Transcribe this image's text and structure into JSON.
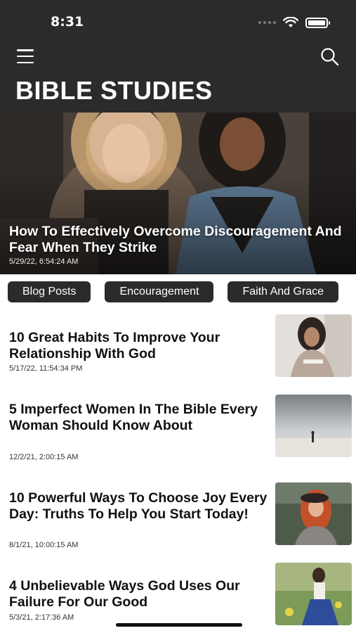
{
  "status_bar": {
    "time": "8:31"
  },
  "header": {
    "title": "BIBLE STUDIES"
  },
  "hero": {
    "title": "How To Effectively Overcome Discouragement And Fear When They Strike",
    "date": "5/29/22, 6:54:24 AM"
  },
  "categories": [
    "Blog Posts",
    "Encouragement",
    "Faith And Grace"
  ],
  "articles": [
    {
      "title": "10 Great Habits To Improve Your Relationship With God",
      "date": "5/17/22, 11:54:34 PM"
    },
    {
      "title": "5 Imperfect Women In The Bible Every Woman Should Know About",
      "date": "12/2/21, 2:00:15 AM"
    },
    {
      "title": "10 Powerful Ways To Choose Joy Every Day: Truths To Help You Start Today!",
      "date": "8/1/21, 10:00:15 AM"
    },
    {
      "title": "4 Unbelievable Ways God Uses Our Failure For Our Good",
      "date": "5/3/21, 2:17:36 AM"
    }
  ]
}
